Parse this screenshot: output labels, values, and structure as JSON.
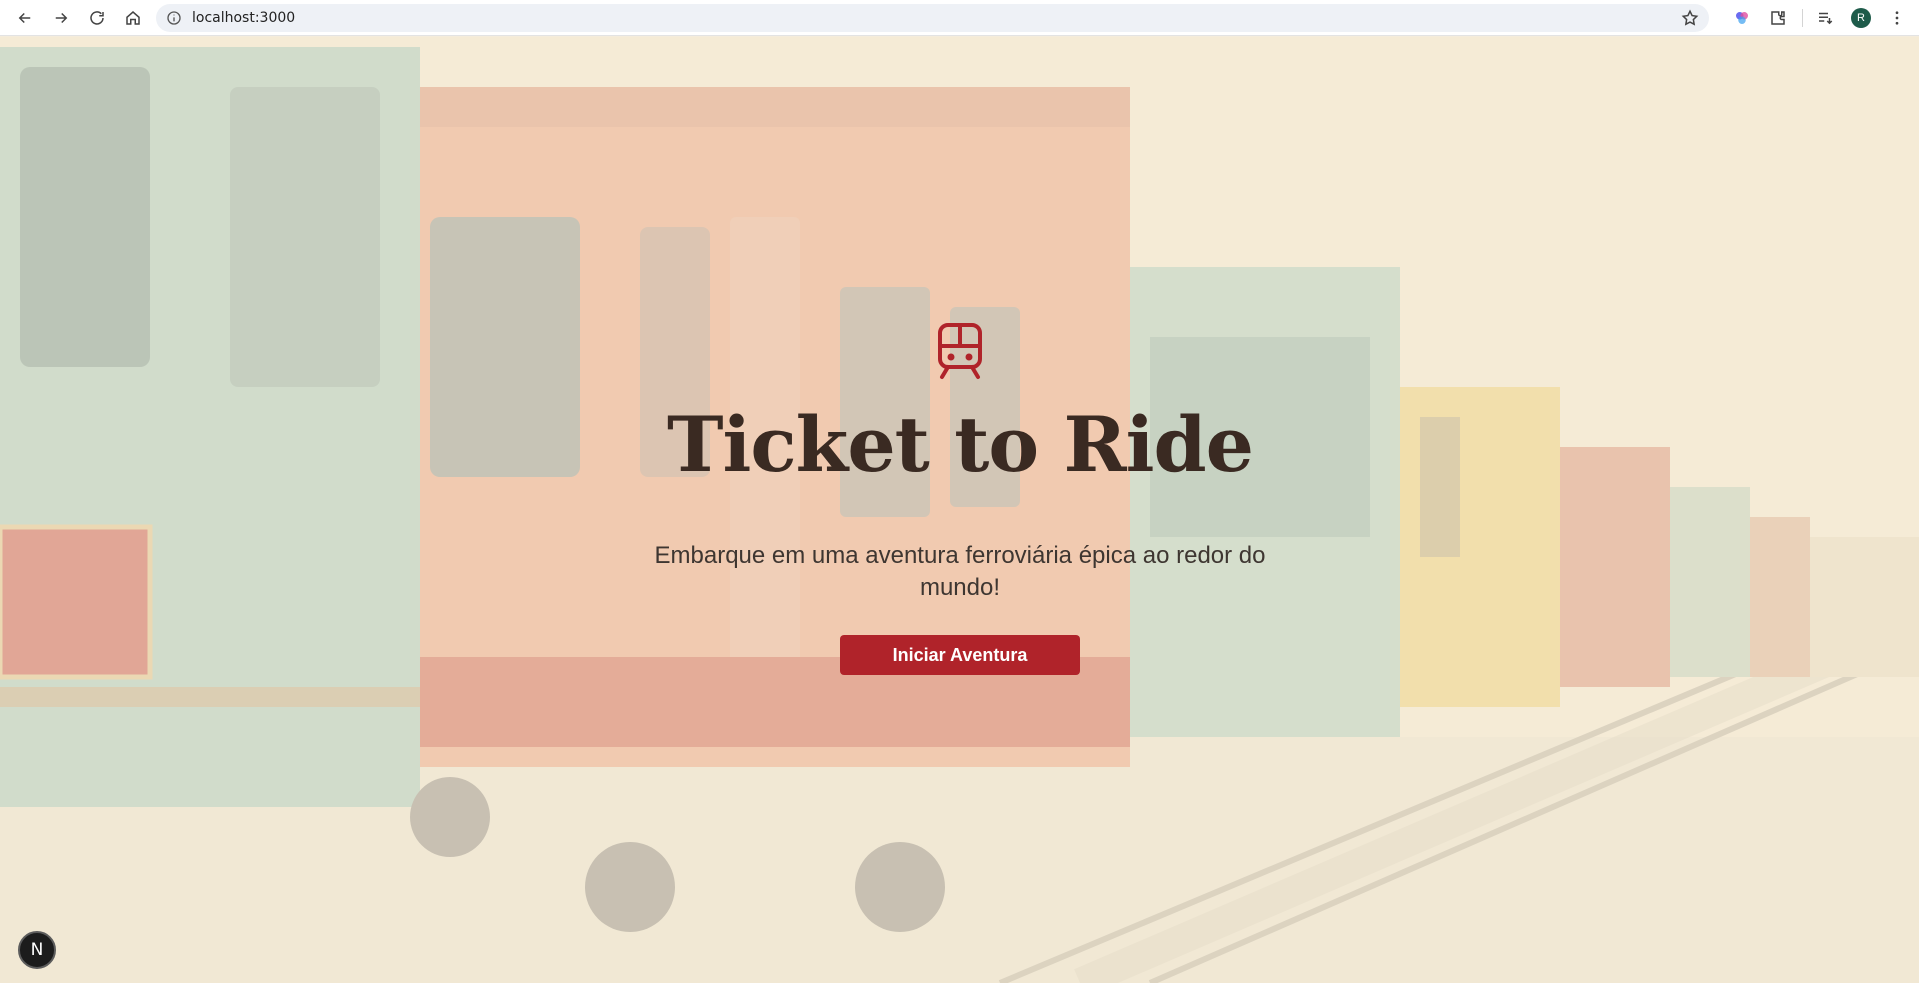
{
  "browser": {
    "url": "localhost:3000",
    "avatar_initial": "R"
  },
  "hero": {
    "icon": "train-front-icon",
    "title": "Ticket to Ride",
    "subtitle": "Embarque em uma aventura ferroviária épica ao redor do mundo!",
    "cta_label": "Iniciar Aventura",
    "accent_color": "#b0232a",
    "dev_badge": "N"
  }
}
